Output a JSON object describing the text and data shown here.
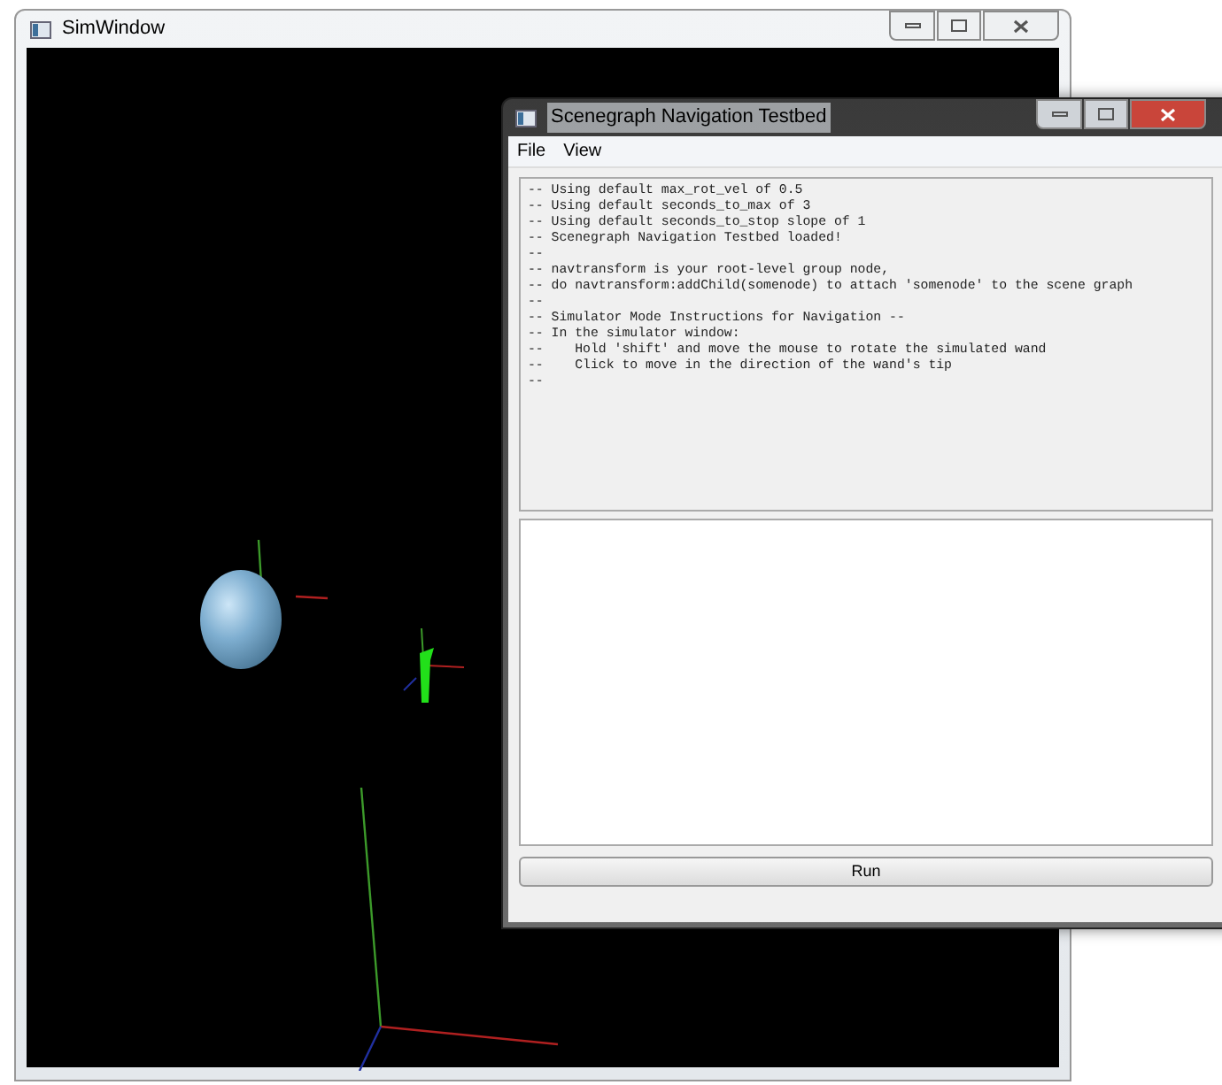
{
  "sim_window": {
    "title": "SimWindow"
  },
  "testbed_window": {
    "title": "Scenegraph Navigation Testbed",
    "menu": [
      "File",
      "View"
    ],
    "log_lines": [
      "-- Using default max_rot_vel of 0.5",
      "-- Using default seconds_to_max of 3",
      "-- Using default seconds_to_stop slope of 1",
      "-- Scenegraph Navigation Testbed loaded!",
      "--",
      "-- navtransform is your root-level group node,",
      "-- do navtransform:addChild(somenode) to attach 'somenode' to the scene graph",
      "--",
      "-- Simulator Mode Instructions for Navigation --",
      "-- In the simulator window:",
      "--    Hold 'shift' and move the mouse to rotate the simulated wand",
      "--    Click to move in the direction of the wand's tip",
      "--"
    ],
    "run_button": "Run"
  }
}
